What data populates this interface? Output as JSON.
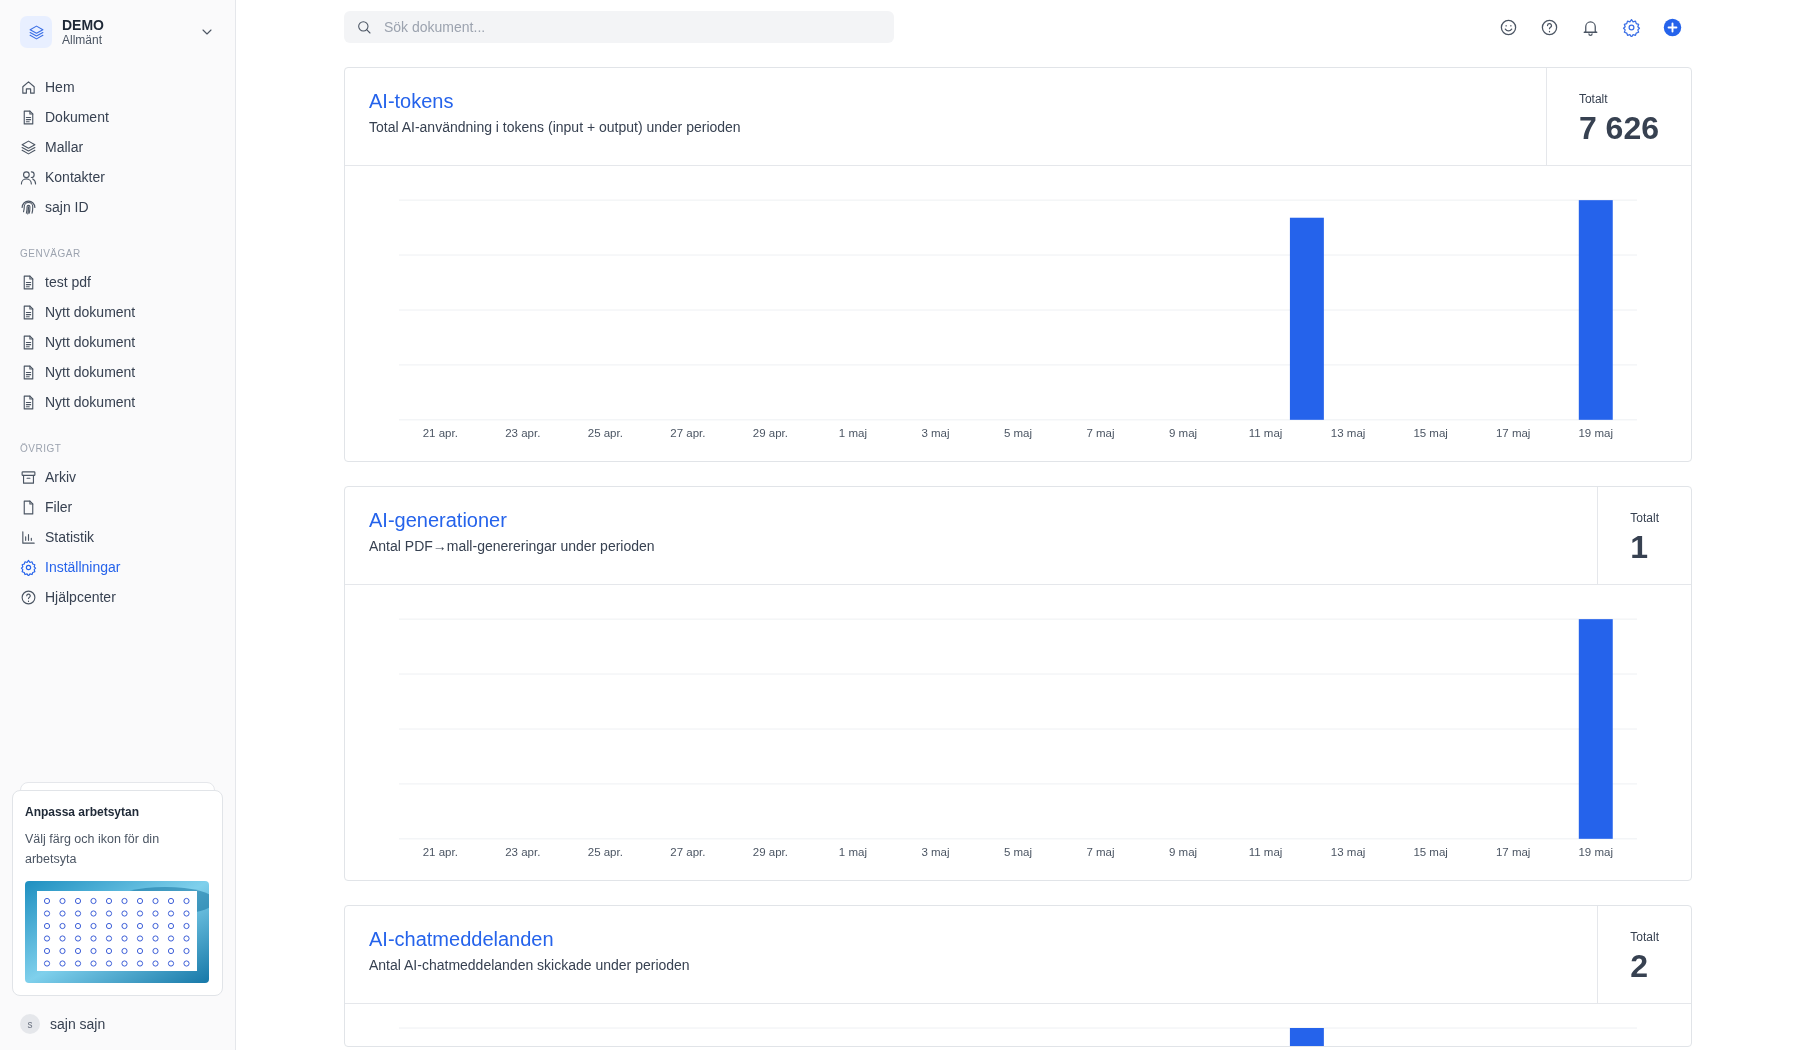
{
  "workspace": {
    "name": "DEMO",
    "subtitle": "Allmänt"
  },
  "nav": [
    {
      "label": "Hem",
      "selected": false
    },
    {
      "label": "Dokument",
      "selected": false
    },
    {
      "label": "Mallar",
      "selected": false
    },
    {
      "label": "Kontakter",
      "selected": false
    },
    {
      "label": "sajn ID",
      "selected": false
    }
  ],
  "sections": [
    {
      "title": "GENVÄGAR",
      "items": [
        {
          "label": "test pdf",
          "selected": false
        },
        {
          "label": "Nytt dokument",
          "selected": false
        },
        {
          "label": "Nytt dokument",
          "selected": false
        },
        {
          "label": "Nytt dokument",
          "selected": false
        },
        {
          "label": "Nytt dokument",
          "selected": false
        }
      ]
    },
    {
      "title": "ÖVRIGT",
      "items": [
        {
          "label": "Arkiv",
          "selected": false
        },
        {
          "label": "Filer",
          "selected": false
        },
        {
          "label": "Statistik",
          "selected": false
        },
        {
          "label": "Inställningar",
          "selected": true
        },
        {
          "label": "Hjälpcenter",
          "selected": false
        }
      ]
    }
  ],
  "promo": {
    "title": "Anpassa arbetsytan",
    "text": "Välj färg och ikon för din arbetsyta",
    "kind": "picture"
  },
  "user": {
    "initial": "s",
    "name": "sajn sajn"
  },
  "search": {
    "placeholder": "Sök dokument..."
  },
  "cards": [
    {
      "title": "AI-tokens",
      "subtitle": "Total AI-användning i tokens (input + output) under perioden",
      "total_label": "Totalt",
      "total": "7 626",
      "x_labels": [
        "21 apr.",
        "23 apr.",
        "25 apr.",
        "27 apr.",
        "29 apr.",
        "1 maj",
        "3 maj",
        "5 maj",
        "7 maj",
        "9 maj",
        "11 maj",
        "13 maj",
        "15 maj",
        "17 maj",
        "19 maj"
      ]
    },
    {
      "title": "AI-generationer",
      "subtitle": "Antal PDF→mall-genereringar under perioden",
      "total_label": "Totalt",
      "total": "1",
      "x_labels": [
        "21 apr.",
        "23 apr.",
        "25 apr.",
        "27 apr.",
        "29 apr.",
        "1 maj",
        "3 maj",
        "5 maj",
        "7 maj",
        "9 maj",
        "11 maj",
        "13 maj",
        "15 maj",
        "17 maj",
        "19 maj"
      ]
    },
    {
      "title": "AI-chatmeddelanden",
      "subtitle": "Antal AI-chatmeddelanden skickade under perioden",
      "total_label": "Totalt",
      "total": "2"
    }
  ]
}
